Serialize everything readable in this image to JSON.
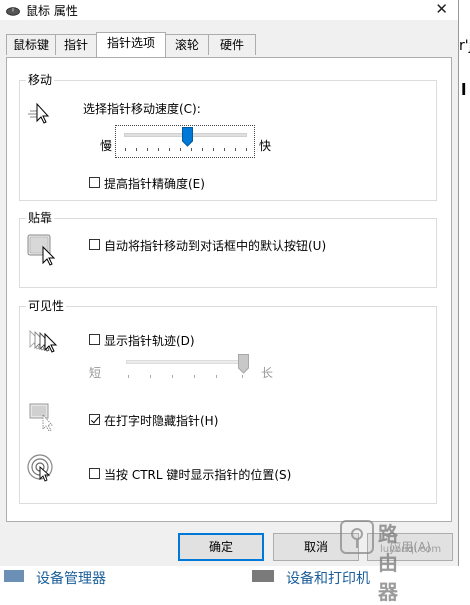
{
  "window": {
    "title": "鼠标 属性",
    "close_glyph": "✕"
  },
  "tabs": [
    {
      "label": "鼠标键",
      "active": false
    },
    {
      "label": "指针",
      "active": false
    },
    {
      "label": "指针选项",
      "active": true
    },
    {
      "label": "滚轮",
      "active": false
    },
    {
      "label": "硬件",
      "active": false
    }
  ],
  "motion": {
    "title": "移动",
    "speed_label": "选择指针移动速度(C):",
    "slow": "慢",
    "fast": "快",
    "speed_value": 0.6,
    "precision_label": "提高指针精确度(E)",
    "precision_checked": false
  },
  "snap": {
    "title": "贴靠",
    "snap_label": "自动将指针移动到对话框中的默认按钮(U)",
    "snap_checked": false
  },
  "visibility": {
    "title": "可见性",
    "trails_label": "显示指针轨迹(D)",
    "trails_checked": false,
    "short": "短",
    "long": "长",
    "trails_value": 1.0,
    "hide_typing_label": "在打字时隐藏指针(H)",
    "hide_typing_checked": true,
    "ctrl_label": "当按 CTRL 键时显示指针的位置(S)",
    "ctrl_checked": false
  },
  "buttons": {
    "ok": "确定",
    "cancel": "取消",
    "apply": "应用(A)"
  },
  "background": {
    "right_text_1": "r'ji",
    "right_text_2": "l",
    "bottom_left": "设备管理器",
    "bottom_right": "设备和打印机"
  },
  "watermark": {
    "line1": "路由器",
    "line2": "luyouqi.com"
  }
}
